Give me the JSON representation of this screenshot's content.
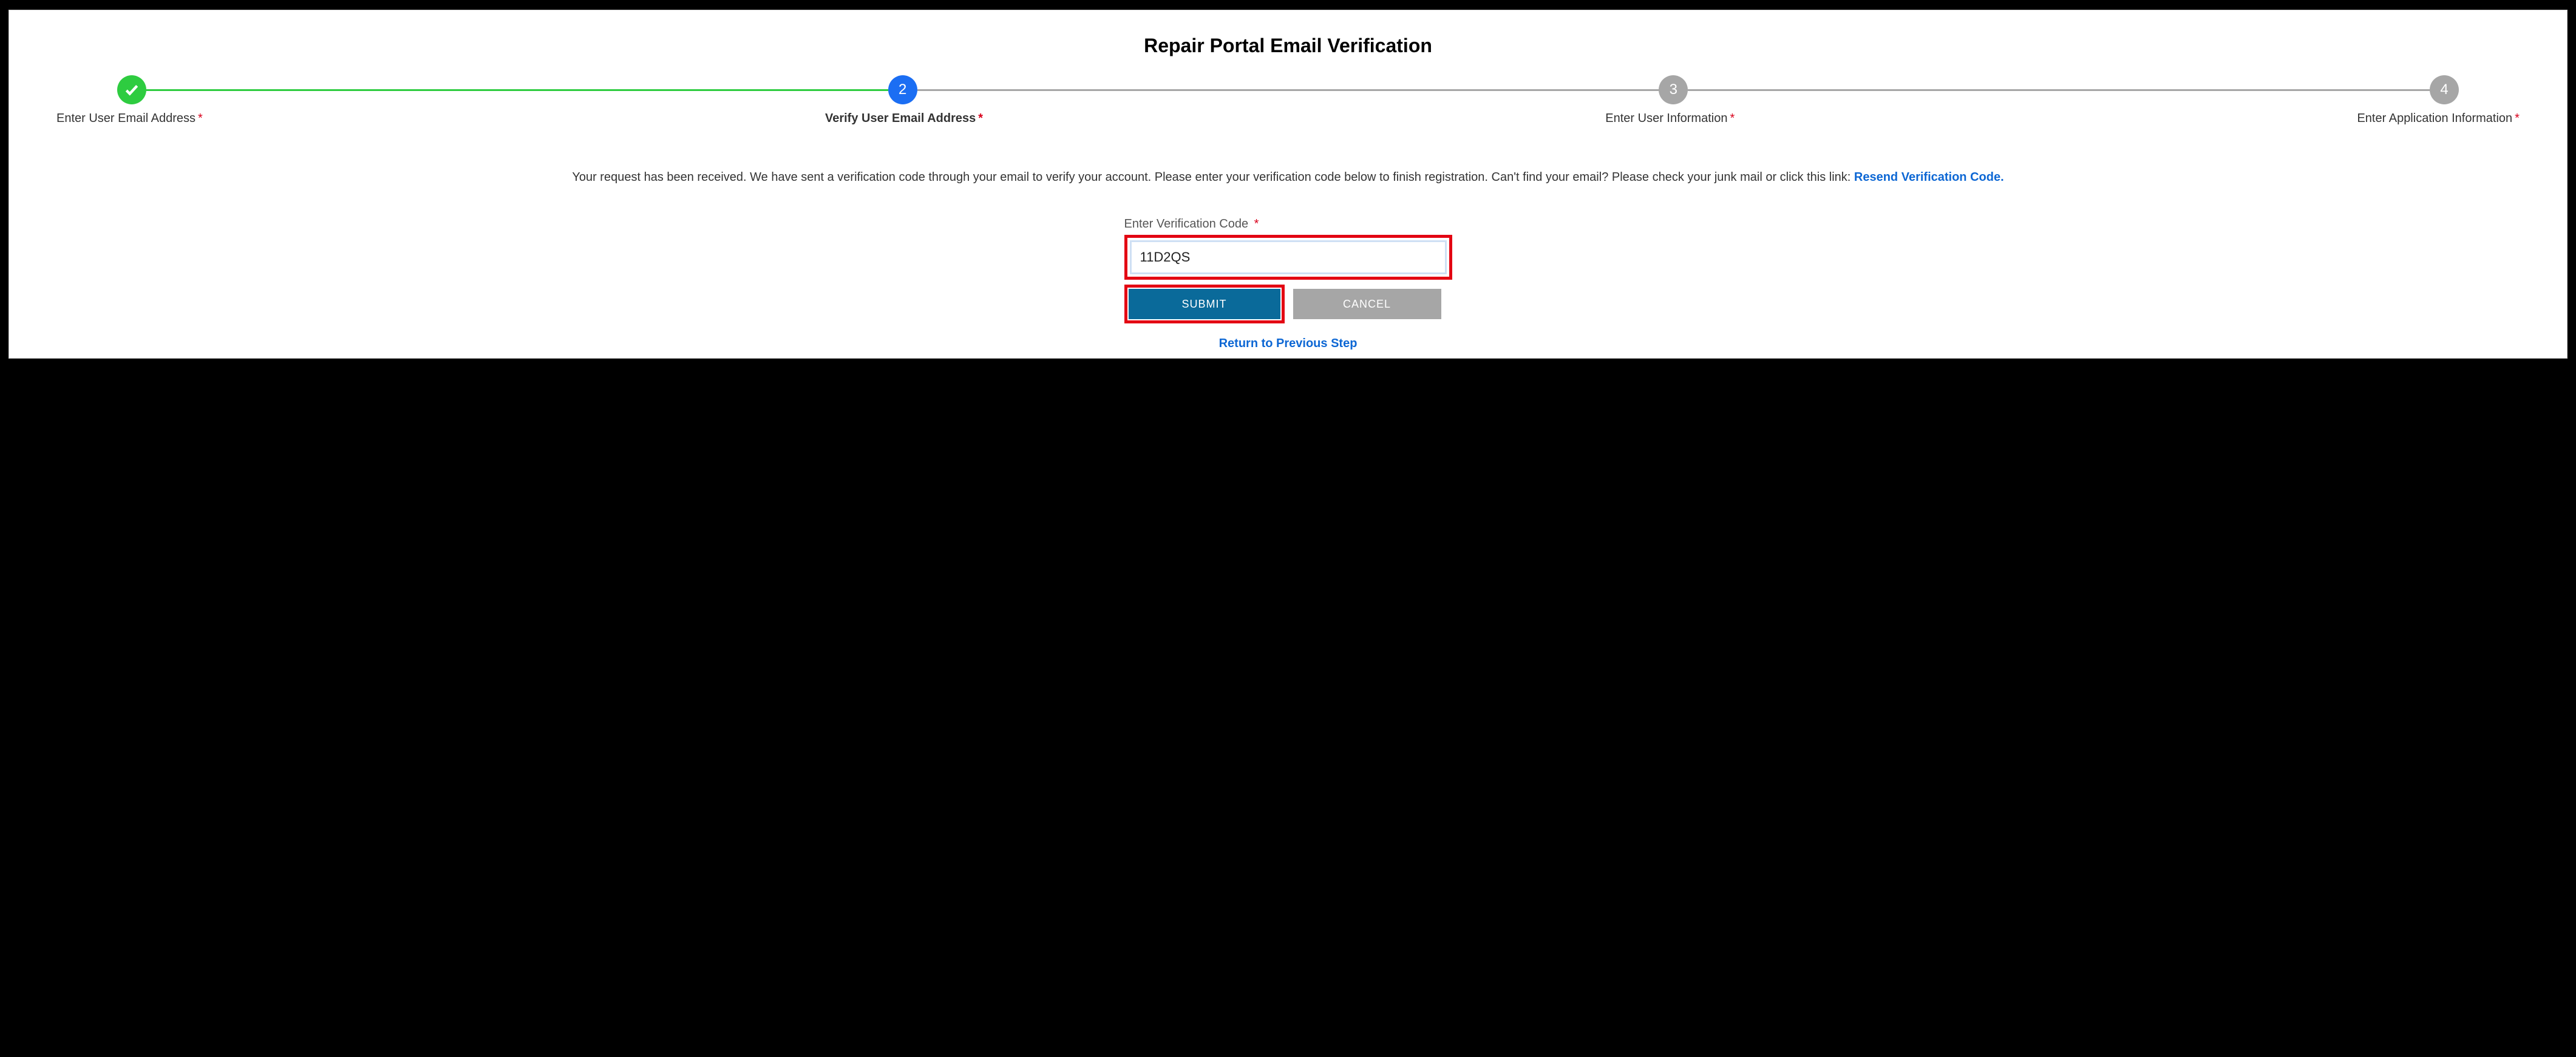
{
  "title": "Repair Portal Email Verification",
  "steps": [
    {
      "label": "Enter User Email Address",
      "state": "done",
      "num": "✓"
    },
    {
      "label": "Verify User Email Address",
      "state": "active",
      "num": "2"
    },
    {
      "label": "Enter User Information",
      "state": "pending",
      "num": "3"
    },
    {
      "label": "Enter Application Information",
      "state": "pending",
      "num": "4"
    }
  ],
  "instructions_pre": "Your request has been received. We have sent a verification code through your email to verify your account. Please enter your verification code below to finish registration. Can't find your email? Please check your junk mail or click this link: ",
  "resend_link_text": "Resend Verification Code.",
  "field_label": "Enter Verification Code",
  "required_marker": "*",
  "code_value": "11D2QS",
  "buttons": {
    "submit": "SUBMIT",
    "cancel": "CANCEL"
  },
  "return_link": "Return to Previous Step"
}
